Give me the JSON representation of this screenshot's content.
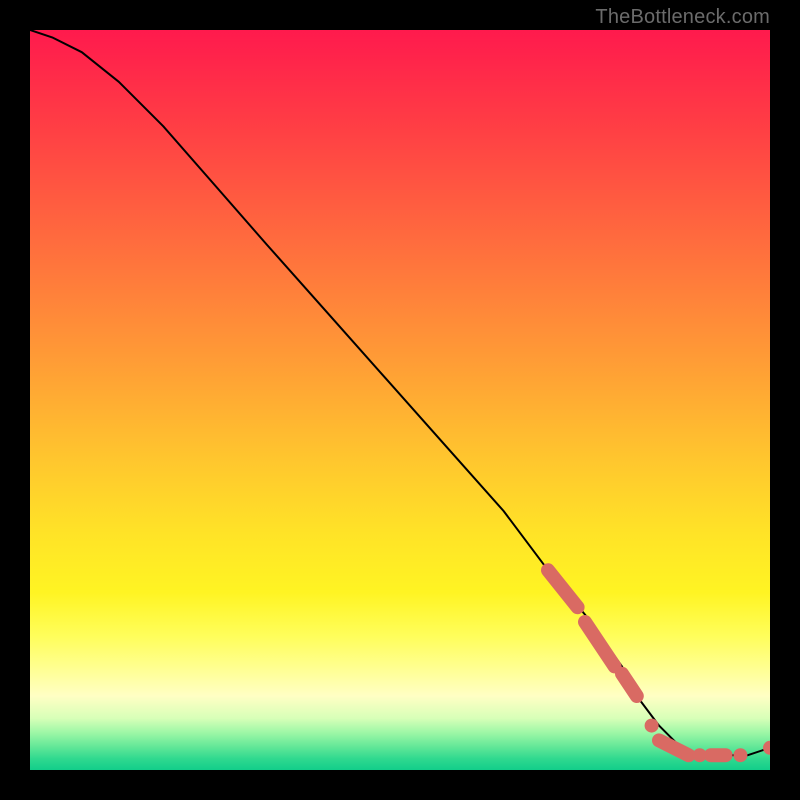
{
  "attribution": "TheBottleneck.com",
  "colors": {
    "dot": "#d96a63",
    "curve": "#000000"
  },
  "chart_data": {
    "type": "line",
    "title": "",
    "xlabel": "",
    "ylabel": "",
    "xlim": [
      0,
      100
    ],
    "ylim": [
      0,
      100
    ],
    "grid": false,
    "series": [
      {
        "name": "curve",
        "x": [
          0,
          3,
          7,
          12,
          18,
          25,
          32,
          40,
          48,
          56,
          64,
          70,
          75,
          80,
          82,
          85,
          88,
          91,
          94,
          97,
          100
        ],
        "y": [
          100,
          99,
          97,
          93,
          87,
          79,
          71,
          62,
          53,
          44,
          35,
          27,
          21,
          14,
          10,
          6,
          3,
          2,
          2,
          2,
          3
        ]
      }
    ],
    "marker_clusters": [
      {
        "kind": "segment",
        "x": [
          70,
          74
        ],
        "y": [
          27,
          22
        ]
      },
      {
        "kind": "segment",
        "x": [
          75,
          79
        ],
        "y": [
          20,
          14
        ]
      },
      {
        "kind": "segment",
        "x": [
          80,
          82
        ],
        "y": [
          13,
          10
        ]
      },
      {
        "kind": "dot",
        "x": 84,
        "y": 6
      },
      {
        "kind": "segment",
        "x": [
          85,
          89
        ],
        "y": [
          4,
          2
        ]
      },
      {
        "kind": "dot",
        "x": 90.5,
        "y": 2
      },
      {
        "kind": "segment",
        "x": [
          92,
          94
        ],
        "y": [
          2,
          2
        ]
      },
      {
        "kind": "dot",
        "x": 96,
        "y": 2
      },
      {
        "kind": "dot",
        "x": 100,
        "y": 3
      }
    ]
  }
}
